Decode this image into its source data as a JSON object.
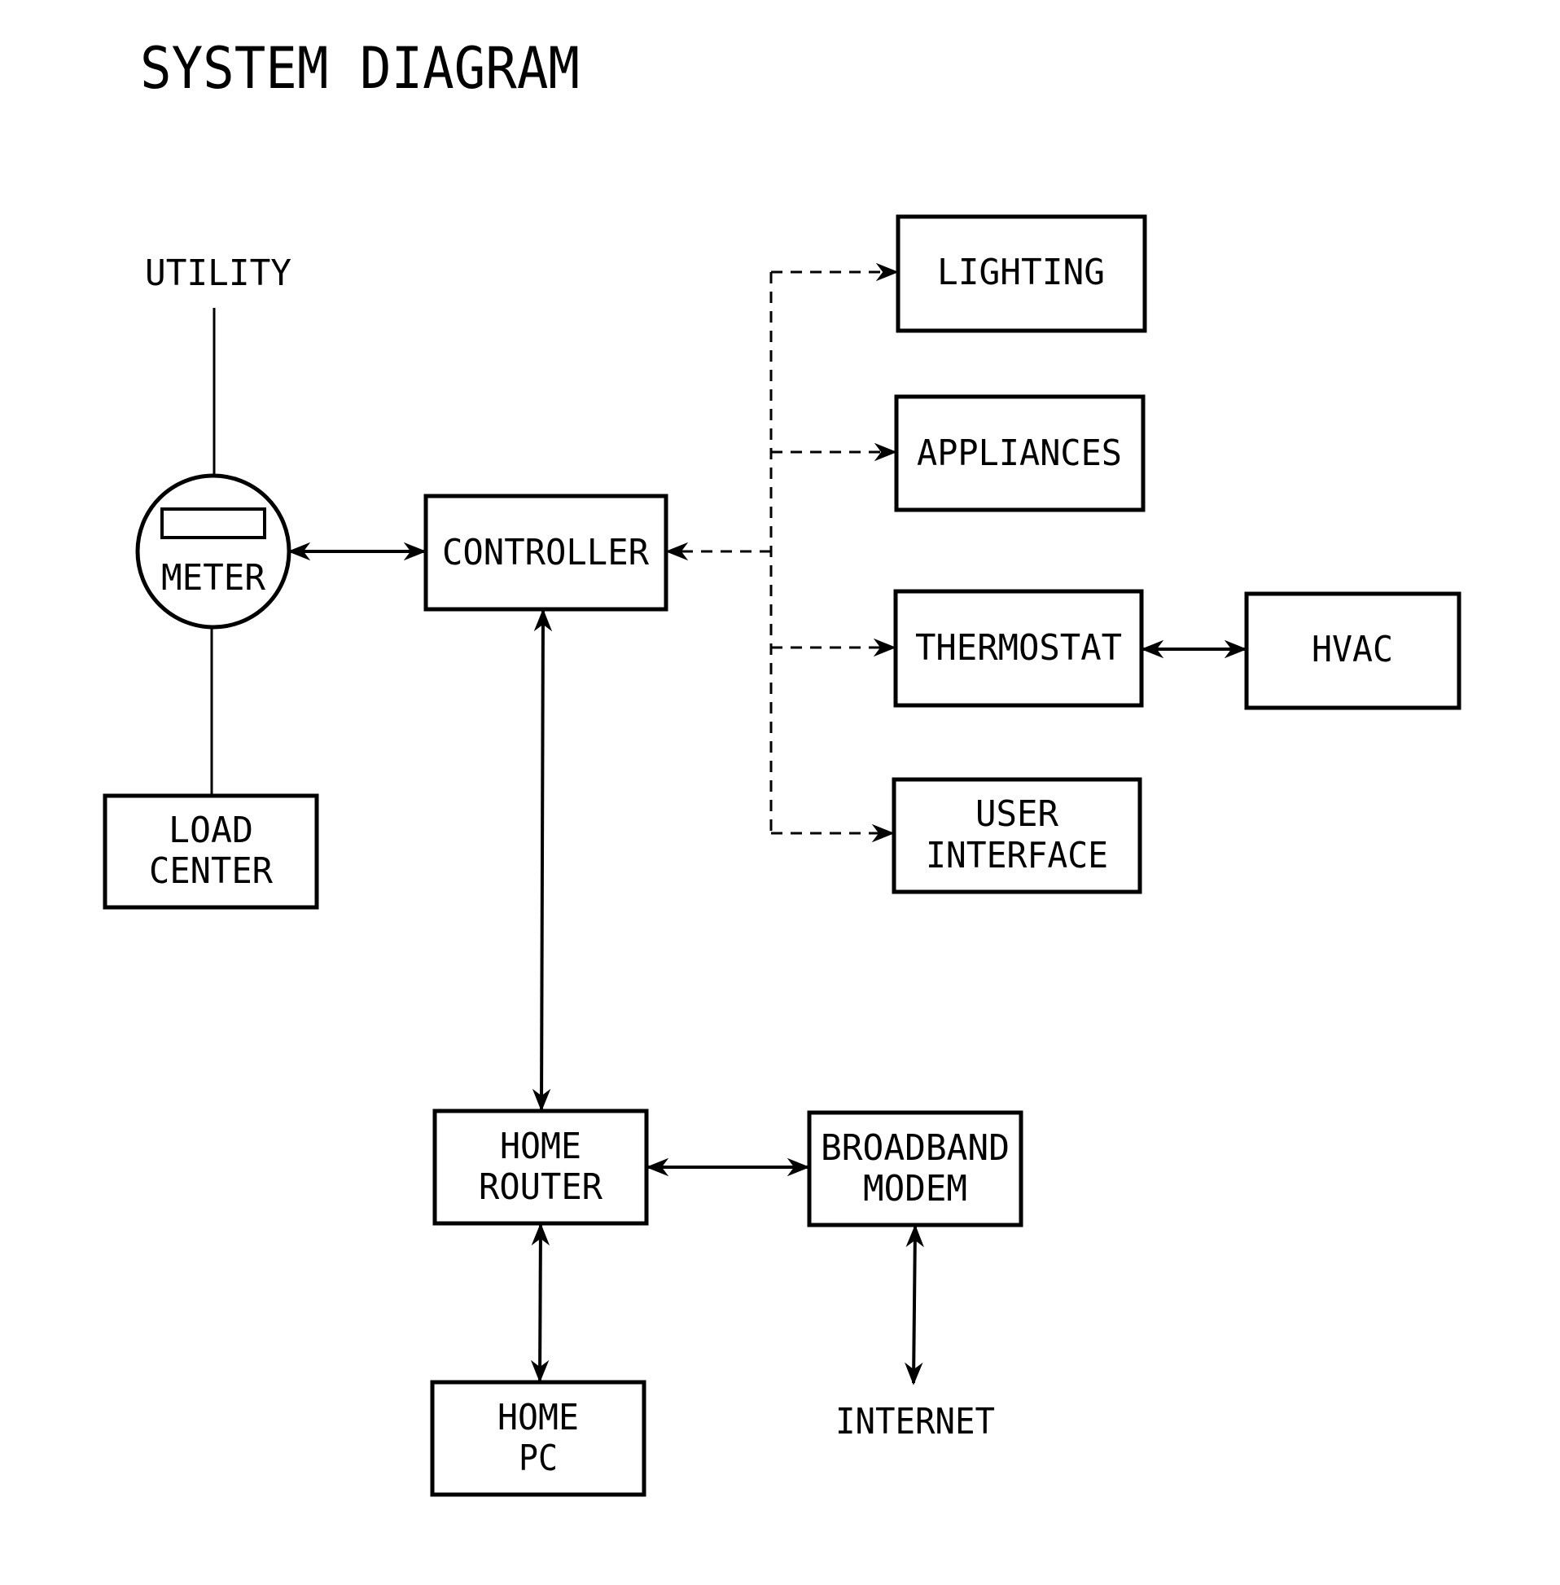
{
  "title": "SYSTEM DIAGRAM",
  "labels": {
    "utility": "UTILITY",
    "internet": "INTERNET"
  },
  "nodes": {
    "meter": [
      "METER"
    ],
    "load_center": [
      "LOAD",
      "CENTER"
    ],
    "controller": [
      "CONTROLLER"
    ],
    "lighting": [
      "LIGHTING"
    ],
    "appliances": [
      "APPLIANCES"
    ],
    "thermostat": [
      "THERMOSTAT"
    ],
    "hvac": [
      "HVAC"
    ],
    "user_interface": [
      "USER",
      "INTERFACE"
    ],
    "home_router": [
      "HOME",
      "ROUTER"
    ],
    "broadband_modem": [
      "BROADBAND",
      "MODEM"
    ],
    "home_pc": [
      "HOME",
      "PC"
    ]
  },
  "connections": [
    {
      "from": "UTILITY",
      "to": "METER",
      "style": "solid",
      "arrows": "none"
    },
    {
      "from": "METER",
      "to": "LOAD CENTER",
      "style": "solid",
      "arrows": "none"
    },
    {
      "from": "METER",
      "to": "CONTROLLER",
      "style": "solid",
      "arrows": "both"
    },
    {
      "from": "CONTROLLER",
      "to": "LIGHTING",
      "style": "dashed",
      "arrows": "both"
    },
    {
      "from": "CONTROLLER",
      "to": "APPLIANCES",
      "style": "dashed",
      "arrows": "both"
    },
    {
      "from": "CONTROLLER",
      "to": "THERMOSTAT",
      "style": "dashed",
      "arrows": "both"
    },
    {
      "from": "CONTROLLER",
      "to": "USER INTERFACE",
      "style": "dashed",
      "arrows": "both"
    },
    {
      "from": "THERMOSTAT",
      "to": "HVAC",
      "style": "solid",
      "arrows": "both"
    },
    {
      "from": "CONTROLLER",
      "to": "HOME ROUTER",
      "style": "solid",
      "arrows": "both"
    },
    {
      "from": "HOME ROUTER",
      "to": "BROADBAND MODEM",
      "style": "solid",
      "arrows": "both"
    },
    {
      "from": "HOME ROUTER",
      "to": "HOME PC",
      "style": "solid",
      "arrows": "both"
    },
    {
      "from": "BROADBAND MODEM",
      "to": "INTERNET",
      "style": "solid",
      "arrows": "both"
    }
  ]
}
